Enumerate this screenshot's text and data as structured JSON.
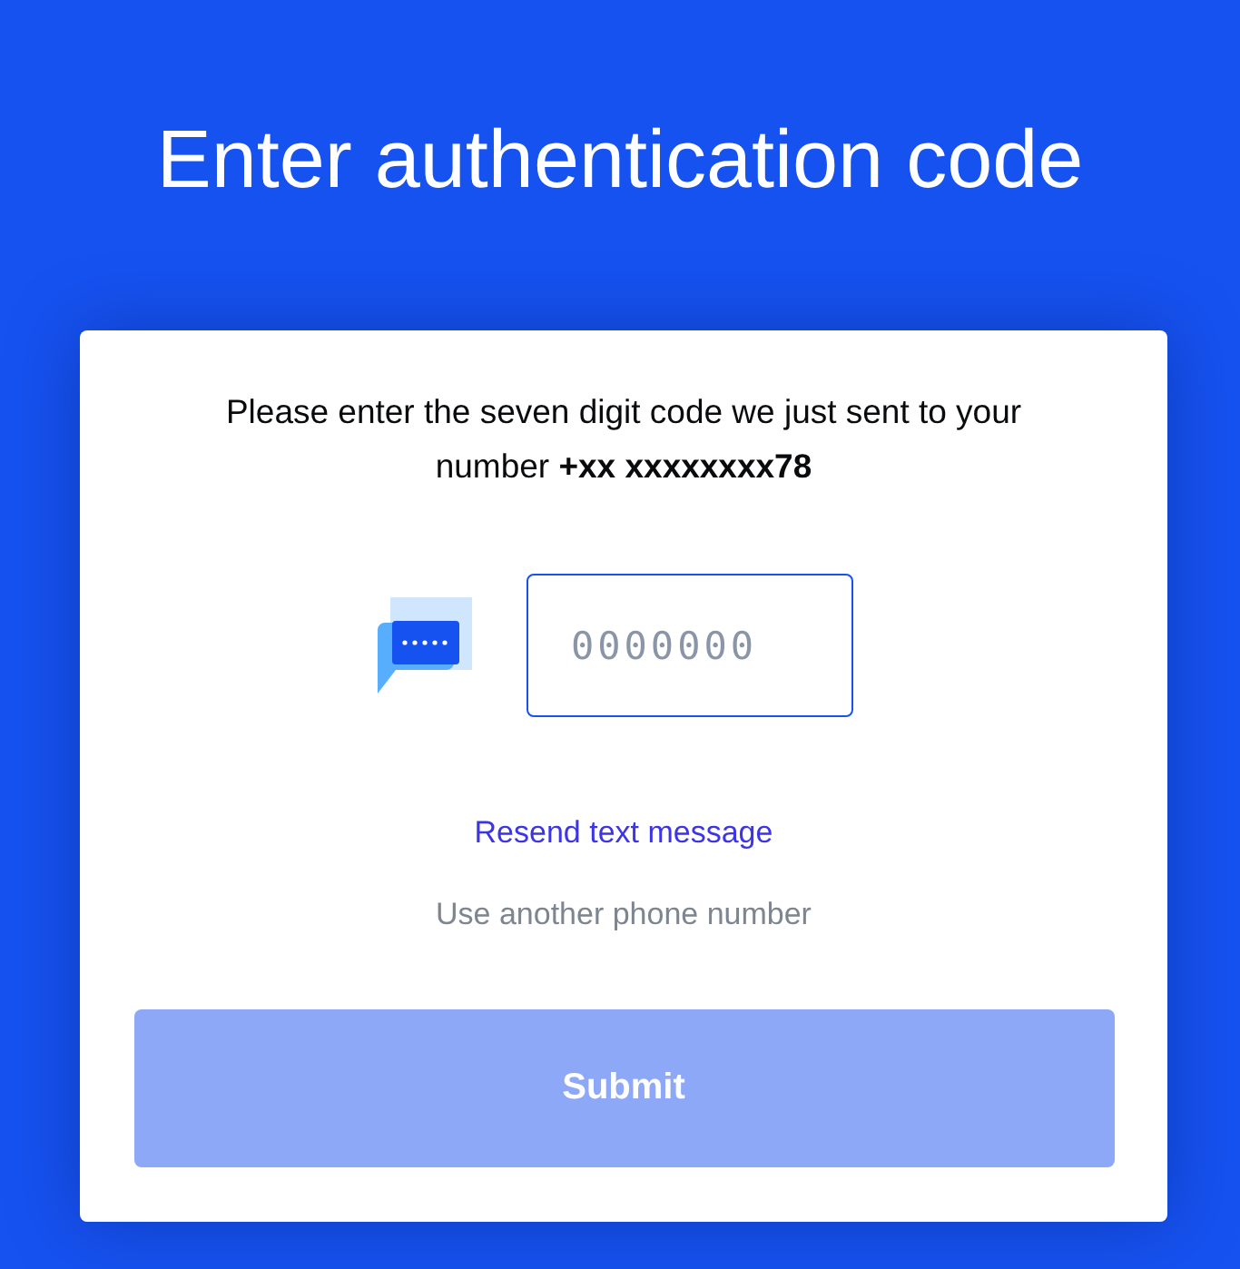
{
  "title": "Enter authentication code",
  "instructions": "Please enter the seven digit code we just sent to your number **+xx xxxxxxxx78**",
  "code_field": {
    "placeholder": "0000000"
  },
  "links": [
    {
      "label": "Resend text message",
      "kind": "primary"
    },
    {
      "label": "Use another phone number",
      "kind": "secondary"
    }
  ],
  "submit": {
    "label": "Submit",
    "disabled": true
  }
}
